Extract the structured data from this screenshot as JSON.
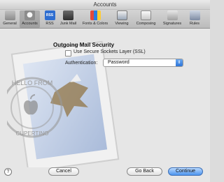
{
  "window": {
    "title": "Accounts"
  },
  "toolbar": {
    "items": [
      {
        "label": "General",
        "icon": "general-icon",
        "active": false
      },
      {
        "label": "Accounts",
        "icon": "accounts-icon",
        "active": true
      },
      {
        "label": "RSS",
        "icon": "rss-icon",
        "active": false
      },
      {
        "label": "Junk Mail",
        "icon": "junk-mail-icon",
        "active": false
      },
      {
        "label": "Fonts & Colors",
        "icon": "fonts-colors-icon",
        "active": false
      },
      {
        "label": "Viewing",
        "icon": "viewing-icon",
        "active": false
      },
      {
        "label": "Composing",
        "icon": "composing-icon",
        "active": false
      },
      {
        "label": "Signatures",
        "icon": "signatures-icon",
        "active": false
      },
      {
        "label": "Rules",
        "icon": "rules-icon",
        "active": false
      }
    ]
  },
  "section": {
    "title": "Outgoing Mail Security",
    "ssl_label": "Use Secure Sockets Layer (SSL)",
    "ssl_checked": false,
    "auth_label": "Authentication:",
    "auth_value": "Password"
  },
  "buttons": {
    "cancel": "Cancel",
    "go_back": "Go Back",
    "continue": "Continue"
  },
  "help": {
    "label": "?"
  },
  "rss_glyph": "RSS",
  "stamp_text": [
    "HELLO FROM",
    "CUPERTINO"
  ]
}
